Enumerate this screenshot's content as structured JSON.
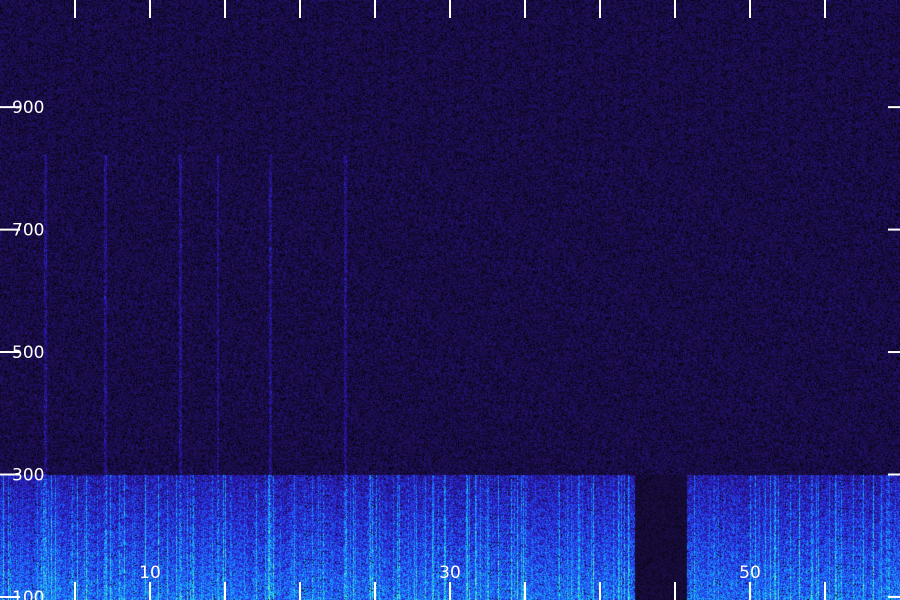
{
  "chart_data": {
    "type": "heatmap",
    "subtype": "spectrogram",
    "x_ticks": [
      10,
      30,
      50
    ],
    "x_tick_labels": [
      "10",
      "30",
      "50"
    ],
    "y_ticks": [
      100,
      300,
      500,
      700,
      900
    ],
    "y_tick_labels": [
      "100",
      "300",
      "500",
      "700",
      "900"
    ],
    "xlim": [
      0,
      60
    ],
    "ylim": [
      95,
      1075
    ],
    "grid": false,
    "colormap": [
      "#000000",
      "#1e0f4e",
      "#2a14b8",
      "#1f5bff",
      "#16c4f0",
      "#7affb0"
    ],
    "intensity_bands": [
      {
        "y_range": [
          95,
          300
        ],
        "level": 0.62
      },
      {
        "y_range": [
          300,
          1075
        ],
        "level": 0.18
      }
    ],
    "vertical_streaks_x": [
      3,
      7,
      12,
      14.5,
      18,
      23
    ],
    "gap_region": {
      "x_range": [
        42.3,
        45.8
      ],
      "y_range": [
        95,
        300
      ]
    },
    "tick_color": "#ffffff",
    "background_color": "#1e0f4e"
  }
}
